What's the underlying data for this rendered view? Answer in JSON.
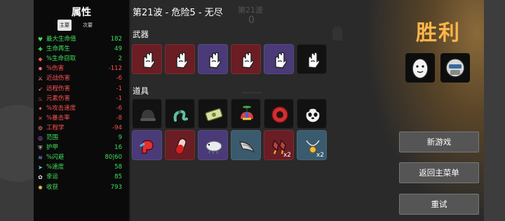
{
  "stats": {
    "title": "属性",
    "tab_primary": "主要",
    "tab_secondary": "次要",
    "rows": [
      {
        "icon": "heart-icon",
        "label": "最大生命值",
        "value": "182",
        "color": "green"
      },
      {
        "icon": "regen-icon",
        "label": "生命再生",
        "value": "49",
        "color": "green"
      },
      {
        "icon": "lifesteal-icon",
        "label": "%生命窃取",
        "value": "2",
        "color": "green"
      },
      {
        "icon": "damage-icon",
        "label": "%伤害",
        "value": "-112",
        "color": "red"
      },
      {
        "icon": "melee-icon",
        "label": "近战伤害",
        "value": "-6",
        "color": "red"
      },
      {
        "icon": "ranged-icon",
        "label": "远程伤害",
        "value": "-1",
        "color": "red"
      },
      {
        "icon": "elemental-icon",
        "label": "元素伤害",
        "value": "-1",
        "color": "red"
      },
      {
        "icon": "attack-speed-icon",
        "label": "%攻击速度",
        "value": "-6",
        "color": "red"
      },
      {
        "icon": "crit-icon",
        "label": "%暴击率",
        "value": "-8",
        "color": "red"
      },
      {
        "icon": "engineering-icon",
        "label": "工程学",
        "value": "-94",
        "color": "red"
      },
      {
        "icon": "range-icon",
        "label": "范围",
        "value": "9",
        "color": "green"
      },
      {
        "icon": "armor-icon",
        "label": "护甲",
        "value": "16",
        "color": "green"
      },
      {
        "icon": "dodge-icon",
        "label": "%闪避",
        "value": "80|60",
        "color": "green"
      },
      {
        "icon": "speed-icon",
        "label": "%速度",
        "value": "58",
        "color": "green"
      },
      {
        "icon": "luck-icon",
        "label": "幸运",
        "value": "85",
        "color": "green"
      },
      {
        "icon": "harvesting-icon",
        "label": "收获",
        "value": "793",
        "color": "green"
      }
    ]
  },
  "header": {
    "title": "第21波 - 危险5 - 无尽",
    "ghost_wave": "第21波",
    "ghost_count": "0"
  },
  "weapons": {
    "title": "武器",
    "slots": [
      {
        "icon": "hand-weapon-icon",
        "tier": "red"
      },
      {
        "icon": "hand-weapon-icon",
        "tier": "red"
      },
      {
        "icon": "hand-weapon-icon",
        "tier": "purple"
      },
      {
        "icon": "hand-weapon-icon",
        "tier": "red"
      },
      {
        "icon": "hand-weapon-icon",
        "tier": "purple"
      },
      {
        "icon": "hand-weapon-icon",
        "tier": "black"
      }
    ]
  },
  "items": {
    "title": "道具",
    "slots": [
      {
        "icon": "helmet-icon",
        "tier": "black",
        "qty": ""
      },
      {
        "icon": "tentacle-icon",
        "tier": "black",
        "qty": ""
      },
      {
        "icon": "banknote-icon",
        "tier": "black",
        "qty": ""
      },
      {
        "icon": "propeller-hat-icon",
        "tier": "black",
        "qty": ""
      },
      {
        "icon": "red-ring-icon",
        "tier": "black",
        "qty": ""
      },
      {
        "icon": "panda-icon",
        "tier": "black",
        "qty": ""
      },
      {
        "icon": "boxing-glove-icon",
        "tier": "purple",
        "qty": ""
      },
      {
        "icon": "potion-vial-icon",
        "tier": "red",
        "qty": ""
      },
      {
        "icon": "tardigrade-icon",
        "tier": "purple",
        "qty": ""
      },
      {
        "icon": "horn-icon",
        "tier": "blue",
        "qty": ""
      },
      {
        "icon": "rocket-feet-icon",
        "tier": "red",
        "qty": "x2"
      },
      {
        "icon": "necklace-icon",
        "tier": "blue",
        "qty": "x2"
      }
    ]
  },
  "result": {
    "title": "胜利",
    "portraits": [
      "egg-character-icon",
      "masked-character-icon"
    ]
  },
  "buttons": {
    "new_game": "新游戏",
    "main_menu": "返回主菜单",
    "retry": "重试"
  },
  "colors": {
    "victory": "#ffb64a",
    "positive": "#3fe05a",
    "negative": "#ff5050",
    "tier_red": "#6b1d24",
    "tier_purple": "#4a3a78",
    "tier_blue": "#3a5a6e"
  }
}
